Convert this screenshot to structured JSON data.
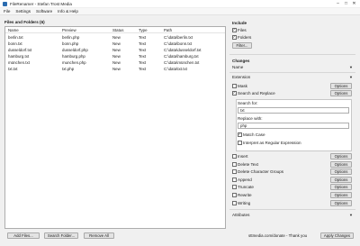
{
  "window": {
    "title": "FileRenamer - Stefan Trost Media"
  },
  "menu": {
    "file": "File",
    "settings": "Settings",
    "software": "Software",
    "info": "Info & Help"
  },
  "files": {
    "heading": "Files and Folders (6)",
    "columns": {
      "name": "Name",
      "preview": "Preview",
      "status": "Status",
      "type": "Type",
      "path": "Path"
    },
    "rows": [
      {
        "name": "berlin.txt",
        "preview": "berlin.php",
        "status": "New",
        "type": "Text",
        "path": "C:\\data\\berlin.txt"
      },
      {
        "name": "bonn.txt",
        "preview": "bonn.php",
        "status": "New",
        "type": "Text",
        "path": "C:\\data\\bonn.txt"
      },
      {
        "name": "dusseldorf.txt",
        "preview": "dusseldorf.php",
        "status": "New",
        "type": "Text",
        "path": "C:\\data\\dusseldorf.txt"
      },
      {
        "name": "hamburg.txt",
        "preview": "hamburg.php",
        "status": "New",
        "type": "Text",
        "path": "C:\\data\\hamburg.txt"
      },
      {
        "name": "münchen.txt",
        "preview": "munchen.php",
        "status": "New",
        "type": "Text",
        "path": "C:\\data\\münchen.txt"
      },
      {
        "name": "txt.txt",
        "preview": "txt.php",
        "status": "New",
        "type": "Text",
        "path": "C:\\data\\txt.txt"
      }
    ],
    "add_files": "Add Files...",
    "search_folder": "Search Folder...",
    "remove_all": "Remove All"
  },
  "include": {
    "heading": "Include",
    "files": "Files",
    "folders": "Folders",
    "files_checked": true,
    "folders_checked": true,
    "filter": "Filter..."
  },
  "changes": {
    "heading": "Changes",
    "name": "Name",
    "extension": "Extension",
    "options": "Options",
    "mask": "Mask",
    "search_replace": "Search and Replace",
    "search_for_label": "Search for:",
    "search_for_value": "txt",
    "replace_with_label": "Replace with:",
    "replace_with_value": "php",
    "match_case": "Match Case",
    "regex": "Interpret as Regular Expression",
    "insert": "Insert",
    "delete_text": "Delete Text",
    "delete_char_groups": "Delete Character Groups",
    "append": "Append",
    "truncate": "Truncate",
    "rewrite": "Rewrite",
    "writing": "Writing",
    "attributes": "Attributes"
  },
  "footer": {
    "donate": "sttmedia.com/donate - Thank you",
    "apply": "Apply Changes"
  },
  "icons": {
    "minimize": "minimize-icon",
    "maximize": "maximize-icon",
    "close": "close-icon",
    "checkmark": "checkmark-icon",
    "triangle": "triangle-down-icon"
  },
  "colors": {
    "table_bg": "#ffffff",
    "window_bg": "#f0f0f0",
    "button_bg": "#e3e3e3"
  }
}
